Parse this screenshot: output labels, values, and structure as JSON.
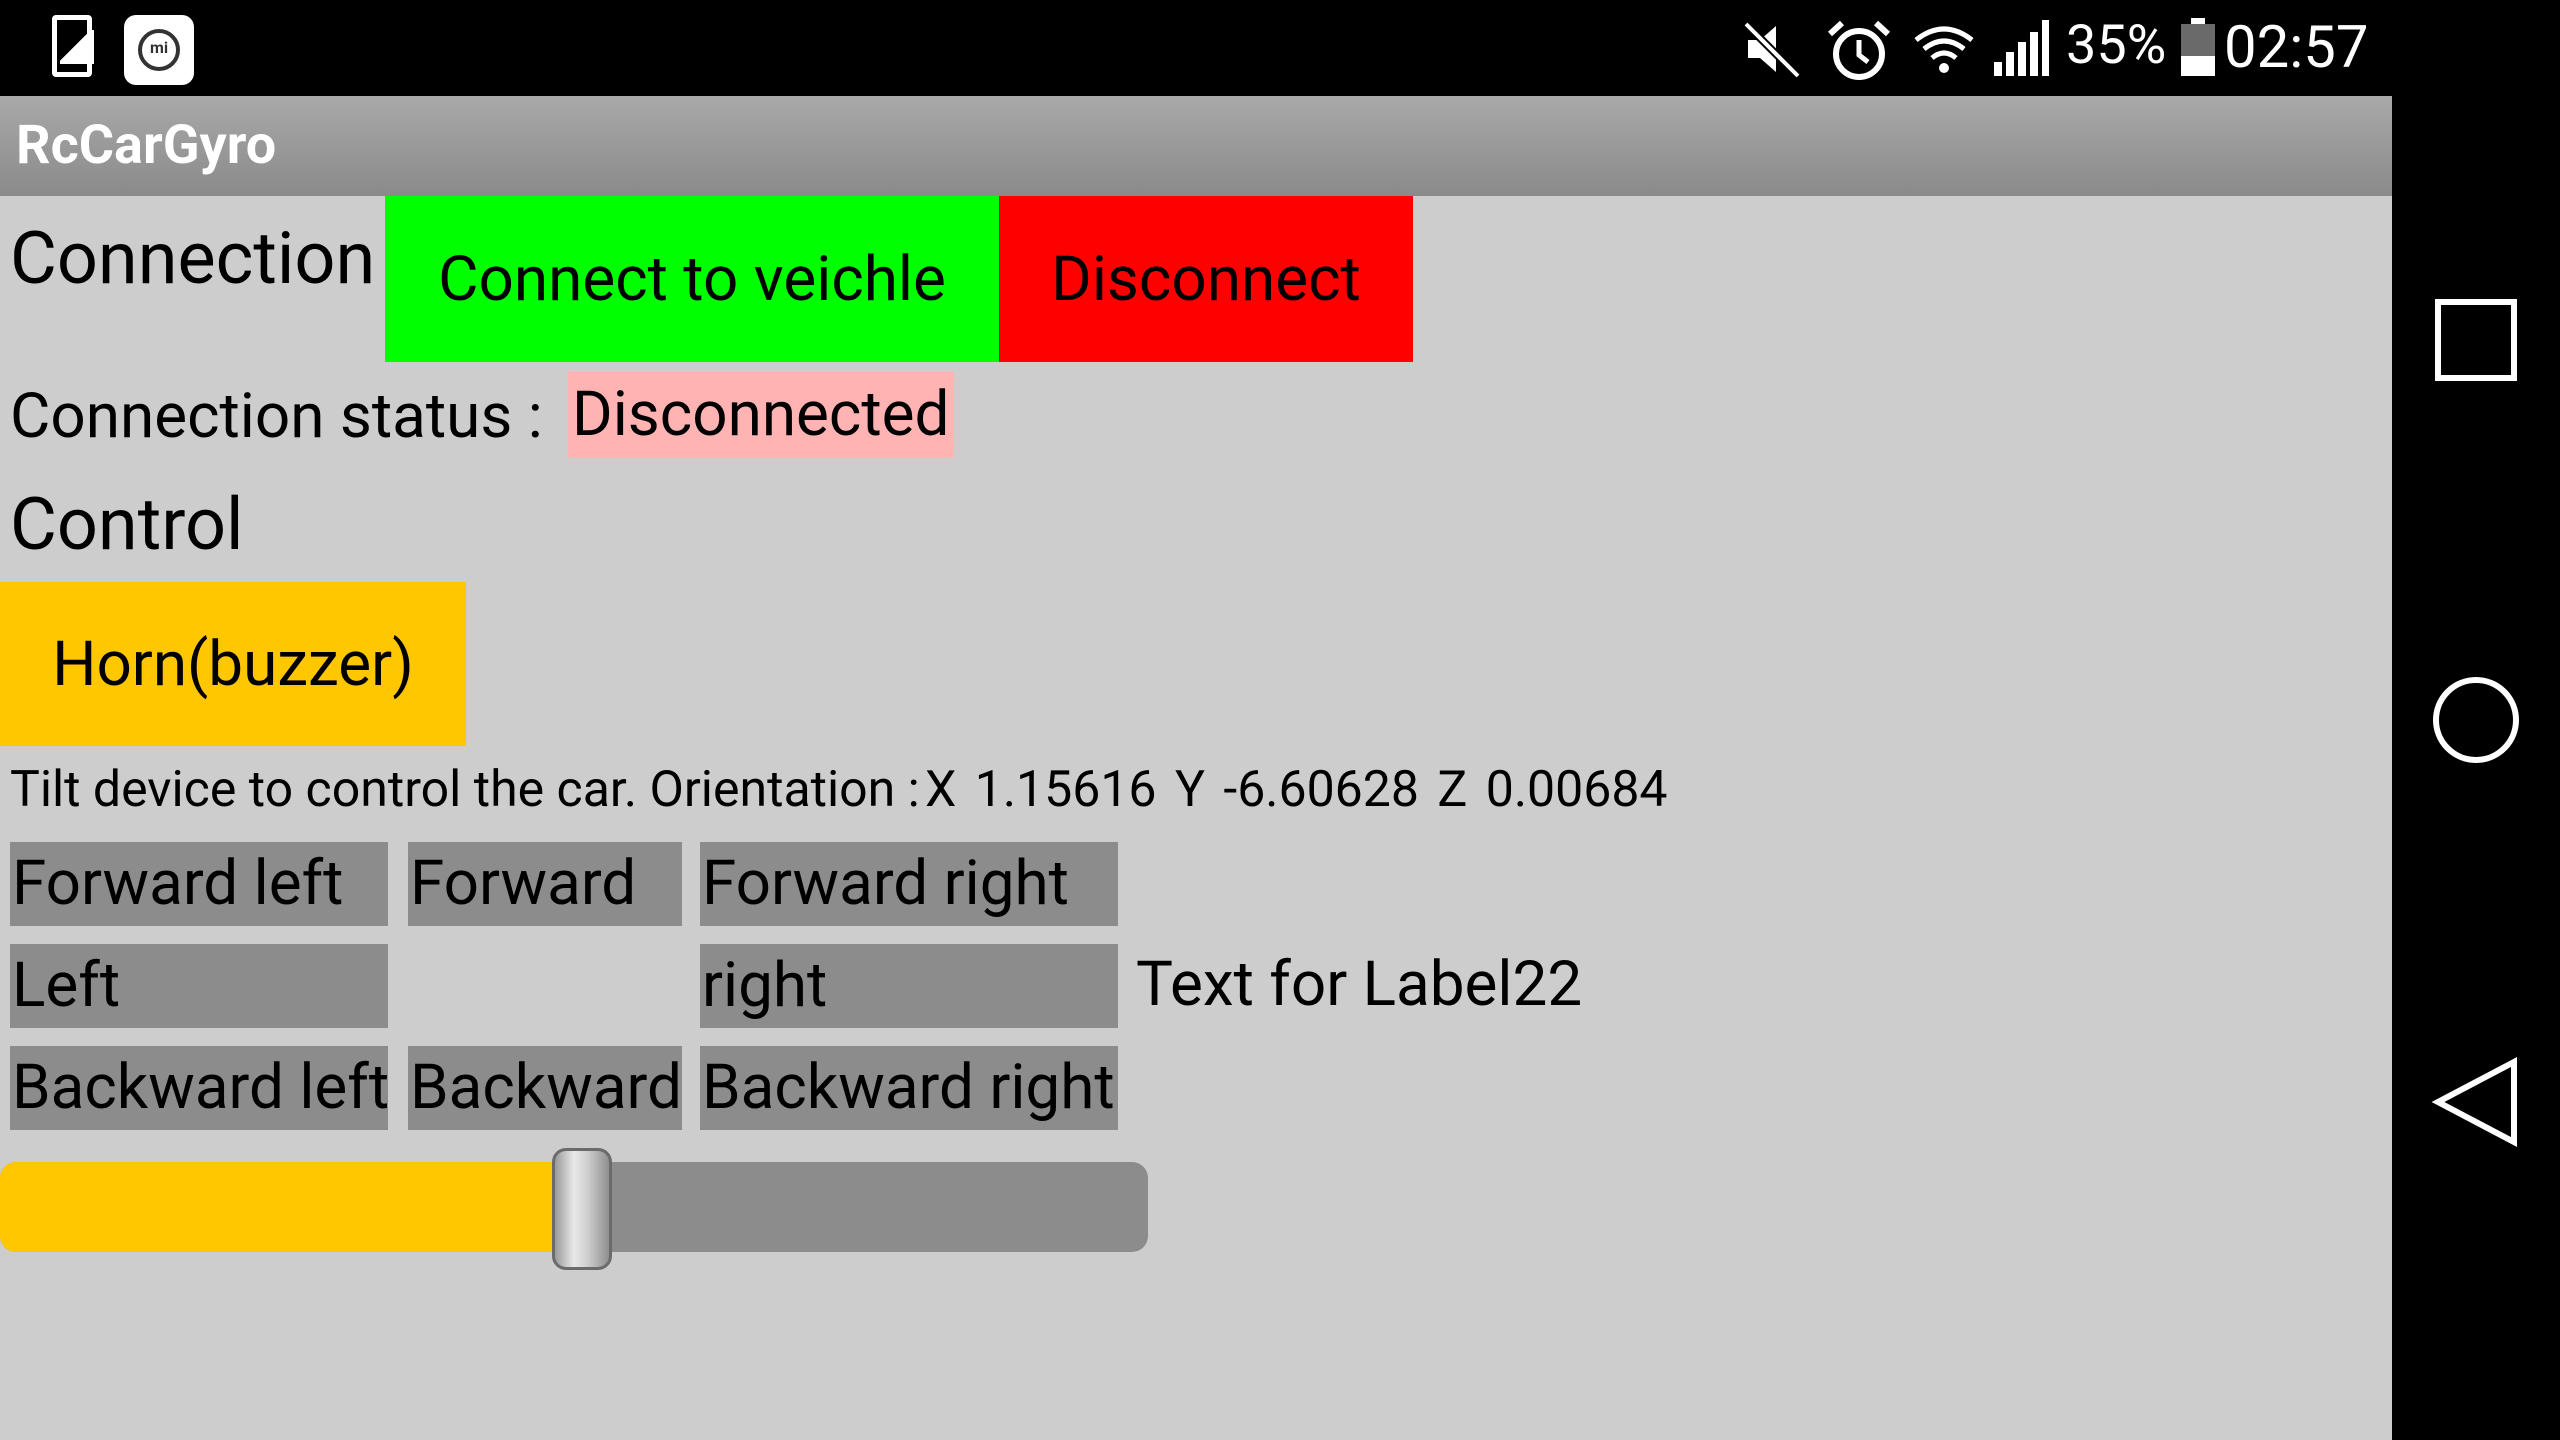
{
  "status_bar": {
    "icons_left": [
      "phone-notification-icon",
      "mi-app-icon"
    ],
    "icons_right": [
      "mute-icon",
      "alarm-icon",
      "wifi-icon",
      "signal-icon"
    ],
    "battery_percent": "35%",
    "time": "02:57"
  },
  "app": {
    "title": "RcCarGyro"
  },
  "connection": {
    "heading": "Connection",
    "connect_label": "Connect to veichle",
    "disconnect_label": "Disconnect",
    "status_label": "Connection status :",
    "status_value": "Disconnected"
  },
  "control": {
    "heading": "Control",
    "horn_label": "Horn(buzzer)",
    "tilt_instruction": "Tilt device to control the car. Orientation :",
    "orientation": "X  1.15616  Y  -6.60628  Z  0.00684",
    "directions": {
      "forward_left": "Forward left",
      "forward": "Forward",
      "forward_right": "Forward right",
      "left": "Left",
      "right": "right",
      "backward_left": "Backward left",
      "backward": "Backward",
      "backward_right": "Backward right"
    },
    "side_label": "Text for Label22",
    "speed_slider_value": 0.5
  },
  "colors": {
    "connect_button": "#00ff00",
    "disconnect_button": "#ff0000",
    "horn_button": "#ffc700",
    "status_value_background": "#ffb3b3",
    "direction_button": "#8c8c8c",
    "content_background": "#cdcdcd",
    "slider_fill": "#ffc700"
  },
  "nav_bar": {
    "buttons": [
      "recents-icon",
      "home-icon",
      "back-icon"
    ]
  }
}
